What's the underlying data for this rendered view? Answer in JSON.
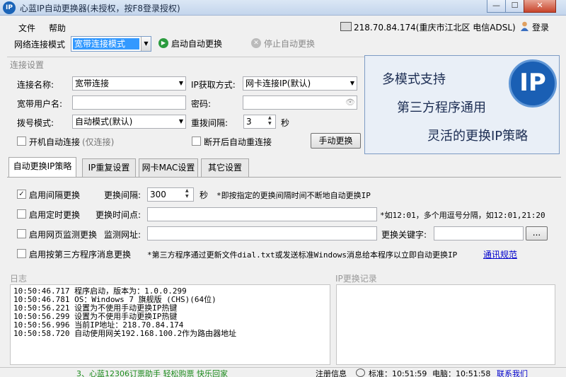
{
  "window": {
    "title": "心蓝IP自动更换器(未授权，按F8登录授权)",
    "icon_text": "IP",
    "buttons": {
      "minimize": "—",
      "maximize": "☐",
      "close": "✕"
    }
  },
  "menu": {
    "file": "文件",
    "help": "帮助"
  },
  "status": {
    "ip_info": "218.70.84.174(重庆市江北区 电信ADSL)",
    "login": "登录"
  },
  "toolbar": {
    "mode_label": "网络连接模式",
    "mode_value": "宽带连接模式",
    "start_label": "启动自动更换",
    "stop_label": "停止自动更换"
  },
  "conn": {
    "legend": "连接设置",
    "name_label": "连接名称:",
    "name_value": "宽带连接",
    "ip_method_label": "IP获取方式:",
    "ip_method_value": "网卡连接IP(默认)",
    "user_label": "宽带用户名:",
    "user_value": "",
    "password_label": "密码:",
    "password_value": "",
    "dial_label": "拨号模式:",
    "dial_value": "自动模式(默认)",
    "redial_label": "重拨间隔:",
    "redial_value": "3",
    "redial_unit": "秒",
    "autostart_label": "开机自动连接",
    "autostart_note": "(仅连接)",
    "reconnect_label": "断开后自动重连接",
    "manual_button": "手动更换"
  },
  "promo": {
    "line1": "多模式支持",
    "line2": "第三方程序通用",
    "line3": "灵活的更换IP策略",
    "logo": "IP"
  },
  "tabs": [
    "自动更换IP策略",
    "IP重复设置",
    "网卡MAC设置",
    "其它设置"
  ],
  "strategy": {
    "interval_label": "启用间隔更换",
    "interval_field_label": "更换间隔:",
    "interval_value": "300",
    "interval_unit": "秒",
    "interval_note": "*即按指定的更换间隔时间不断地自动更换IP",
    "timed_label": "启用定时更换",
    "timed_field_label": "更换时间点:",
    "timed_value": "",
    "timed_note": "*如12:01，多个用逗号分隔，如12:01,21:20",
    "web_label": "启用网页监测更换",
    "web_field_label": "监测网址:",
    "web_value": "",
    "keyword_label": "更换关键字:",
    "keyword_value": "",
    "browse_button": "...",
    "third_label": "启用按第三方程序消息更换",
    "third_note": "*第三方程序通过更新文件dial.txt或发送标准Windows消息给本程序以立即自动更换IP",
    "third_link": "通讯规范"
  },
  "log": {
    "title": "日志",
    "lines": [
      "10:50:46.717 程序启动，版本为：1.0.0.299",
      "10:50:46.781 OS：Windows 7 旗舰版 (CHS)(64位)",
      "10:50:56.221 设置为不使用手动更换IP热键",
      "10:50:56.299 设置为不使用手动更换IP热键",
      "10:50:56.996 当前IP地址：218.70.84.174",
      "10:50:58.720 自动使用网关192.168.100.2作为路由器地址"
    ]
  },
  "iplog": {
    "title": "IP更换记录"
  },
  "statusbar": {
    "ad": "3、心蓝12306订票助手 轻松购票 快乐回家",
    "register": "注册信息",
    "standard_time": "标准：10:51:59",
    "pc_time": "电脑：10:51:58",
    "contact": "联系我们"
  }
}
